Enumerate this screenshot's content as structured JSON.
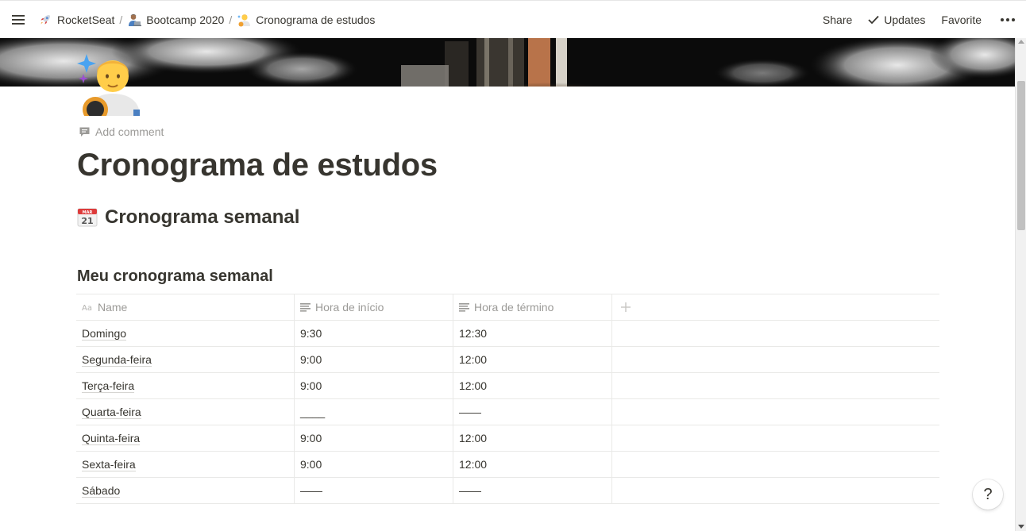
{
  "topbar": {
    "breadcrumbs": [
      {
        "label": "RocketSeat",
        "icon": "rocket-icon"
      },
      {
        "label": "Bootcamp 2020",
        "icon": "technologist-icon"
      },
      {
        "label": "Cronograma de estudos",
        "icon": "astronaut-icon"
      }
    ],
    "separator": "/",
    "share_label": "Share",
    "updates_label": "Updates",
    "favorite_label": "Favorite"
  },
  "page": {
    "icon": "astronaut-icon",
    "add_comment": "Add comment",
    "title": "Cronograma de estudos",
    "heading": "Cronograma semanal",
    "heading_icon": "calendar-icon"
  },
  "database": {
    "title": "Meu cronograma semanal",
    "columns": [
      "Name",
      "Hora de início",
      "Hora de término"
    ],
    "rows": [
      {
        "name": "Domingo",
        "start": "9:30",
        "end": "12:30"
      },
      {
        "name": "Segunda-feira",
        "start": "9:00",
        "end": "12:00"
      },
      {
        "name": "Terça-feira",
        "start": "9:00",
        "end": "12:00"
      },
      {
        "name": "Quarta-feira",
        "start": "____",
        "end": "——"
      },
      {
        "name": "Quinta-feira",
        "start": "9:00",
        "end": "12:00"
      },
      {
        "name": "Sexta-feira",
        "start": "9:00",
        "end": "12:00"
      },
      {
        "name": "Sábado",
        "start": "——",
        "end": "——"
      }
    ]
  },
  "help_label": "?",
  "colors": {
    "text": "#37352f",
    "muted": "#9b9a97",
    "border": "#e9e9e7"
  }
}
